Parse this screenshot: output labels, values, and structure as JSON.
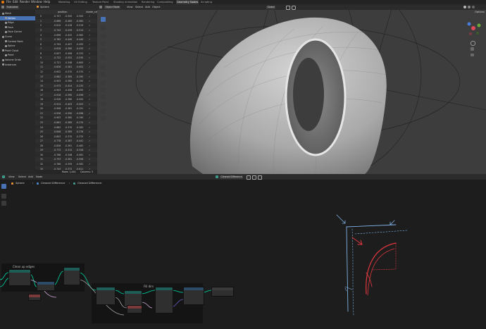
{
  "topbar": {
    "menus": [
      "File",
      "Edit",
      "Render",
      "Window",
      "Help"
    ],
    "workspaces": [
      "Modeling",
      "UV Editing",
      "Texture Paint",
      "Shading",
      "Animation",
      "Rendering",
      "Compositing",
      "Geometry Nodes",
      "Scripting"
    ],
    "active_workspace": "Geometry Nodes",
    "scene": "Options"
  },
  "outliner": {
    "header_value": "Evaluated",
    "items": [
      {
        "label": "Mesh",
        "indent": 0,
        "color": "#9a9a9a",
        "selected": false
      },
      {
        "label": "Vertex",
        "indent": 1,
        "color": "#9a9a9a",
        "selected": true
      },
      {
        "label": "Edge",
        "indent": 1,
        "color": "#9a9a9a",
        "selected": false
      },
      {
        "label": "Face",
        "indent": 1,
        "color": "#9a9a9a",
        "selected": false
      },
      {
        "label": "Face Corner",
        "indent": 1,
        "color": "#9a9a9a",
        "selected": false
      },
      {
        "label": "Curve",
        "indent": 0,
        "color": "#9a9a9a",
        "selected": false
      },
      {
        "label": "Control Point",
        "indent": 1,
        "color": "#9a9a9a",
        "selected": false
      },
      {
        "label": "Spline",
        "indent": 1,
        "color": "#9a9a9a",
        "selected": false
      },
      {
        "label": "Point Cloud",
        "indent": 0,
        "color": "#9a9a9a",
        "selected": false
      },
      {
        "label": "Point",
        "indent": 1,
        "color": "#9a9a9a",
        "selected": false
      },
      {
        "label": "Volume Grids",
        "indent": 0,
        "color": "#9a9a9a",
        "selected": false
      },
      {
        "label": "Instances",
        "indent": 0,
        "color": "#9a9a9a",
        "selected": false
      }
    ]
  },
  "spreadsheet": {
    "object": "Sphere",
    "columns": [
      "",
      "position",
      "",
      "",
      "shade_sm"
    ],
    "rows": [
      [
        "0",
        "-0.707",
        "-0.500",
        "-0.500",
        "✓"
      ],
      [
        "1",
        "-0.666",
        "-0.465",
        "-0.582",
        "✓"
      ],
      [
        "2",
        "-0.610",
        "-0.418",
        "-0.519",
        "✓"
      ],
      [
        "3",
        "-0.742",
        "-0.439",
        "-0.514",
        "✓"
      ],
      [
        "4",
        "-0.696",
        "-0.422",
        "-0.582",
        "✓"
      ],
      [
        "5",
        "-0.762",
        "-0.440",
        "-0.440",
        "✓"
      ],
      [
        "6",
        "-0.794",
        "-0.407",
        "-0.455",
        "✓"
      ],
      [
        "7",
        "-0.818",
        "-0.380",
        "-0.433",
        "✓"
      ],
      [
        "8",
        "-0.627",
        "-0.408",
        "-0.222",
        "✓"
      ],
      [
        "9",
        "-0.722",
        "-0.352",
        "-0.530",
        "✓"
      ],
      [
        "10",
        "-0.721",
        "-0.348",
        "-0.600",
        "✓"
      ],
      [
        "11",
        "-0.826",
        "-0.381",
        "-0.002",
        "✓"
      ],
      [
        "12",
        "-0.652",
        "-0.570",
        "-0.370",
        "✓"
      ],
      [
        "13",
        "-0.882",
        "-0.385",
        "-0.290",
        "✓"
      ],
      [
        "14",
        "-0.903",
        "-0.380",
        "-0.190",
        "✓"
      ],
      [
        "15",
        "-0.975",
        "-0.424",
        "-0.235",
        "✓"
      ],
      [
        "16",
        "-0.903",
        "-0.458",
        "-0.095",
        "✓"
      ],
      [
        "17",
        "-0.916",
        "-0.390",
        "-0.096",
        "✓"
      ],
      [
        "18",
        "-0.926",
        "-0.380",
        "-0.000",
        "✓"
      ],
      [
        "19",
        "-0.914",
        "-0.403",
        "-0.003",
        "✓"
      ],
      [
        "20",
        "-0.906",
        "-0.381",
        "-0.151",
        "✓"
      ],
      [
        "21",
        "-0.926",
        "-0.390",
        "-0.096",
        "✓"
      ],
      [
        "22",
        "-0.903",
        "-0.380",
        "-0.190",
        "✓"
      ],
      [
        "23",
        "-0.861",
        "-0.385",
        "-0.270",
        "✓"
      ],
      [
        "24",
        "-0.882",
        "-0.370",
        "-0.282",
        "✓"
      ],
      [
        "25",
        "-0.846",
        "-0.385",
        "-0.278",
        "✓"
      ],
      [
        "26",
        "-0.802",
        "-0.370",
        "-0.370",
        "✓"
      ],
      [
        "27",
        "-0.778",
        "-0.387",
        "-0.441",
        "✓"
      ],
      [
        "28",
        "-0.828",
        "-0.361",
        "-0.462",
        "✓"
      ],
      [
        "29",
        "-0.772",
        "-0.312",
        "-0.528",
        "✓"
      ],
      [
        "30",
        "-0.768",
        "-0.348",
        "-0.561",
        "✓"
      ],
      [
        "31",
        "-0.753",
        "-0.361",
        "-0.556",
        "✓"
      ],
      [
        "32",
        "-0.786",
        "-0.359",
        "-0.582",
        "✓"
      ],
      [
        "33",
        "-0.743",
        "-0.372",
        "-0.611",
        "✓"
      ]
    ],
    "footer_rows": "Rows: 1,444",
    "footer_cols": "Columns: 3"
  },
  "viewport": {
    "mode": "Object Mode",
    "menus": [
      "View",
      "Select",
      "Add",
      "Object"
    ],
    "transform": "Global",
    "options": "Options"
  },
  "node_editor": {
    "menus": [
      "View",
      "Select",
      "Add",
      "Node"
    ],
    "breadcrumb": [
      "Sphere",
      "Cleaned Difference",
      "Cleaned Difference"
    ],
    "tree_name": "Cleaned Difference",
    "frames": [
      {
        "label": "Clean up edges"
      },
      {
        "label": "Fill dirs"
      }
    ],
    "colors": {
      "header_geometry": "#1f5e58",
      "header_utility": "#2d4a66",
      "header_input": "#7a3a3a",
      "sketch_blue": "#7fb2e6",
      "sketch_red": "#e0383f"
    }
  }
}
